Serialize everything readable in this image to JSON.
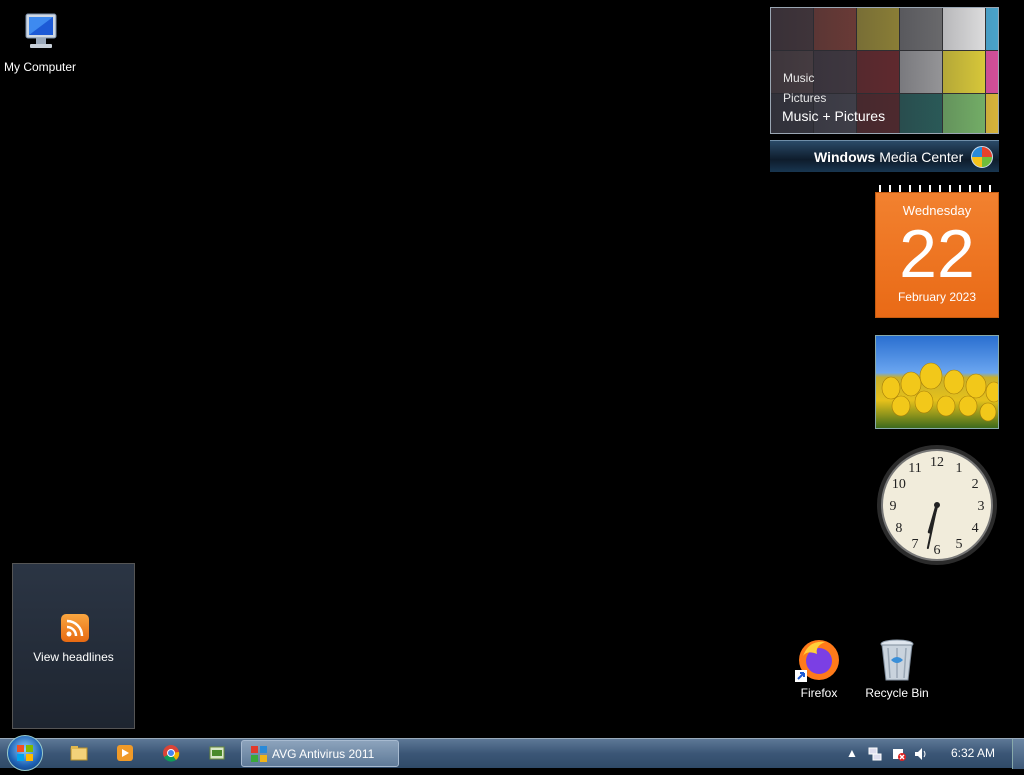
{
  "desktop": {
    "icons": [
      {
        "label": "My Computer",
        "icon": "computer-icon"
      },
      {
        "label": "Firefox",
        "icon": "firefox-icon"
      },
      {
        "label": "Recycle Bin",
        "icon": "recycle-bin-icon"
      }
    ]
  },
  "gadgets": {
    "media_center": {
      "menu": [
        "Music",
        "Pictures"
      ],
      "active": "Music + Pictures",
      "brand_bold": "Windows",
      "brand_rest": " Media Center"
    },
    "calendar": {
      "weekday": "Wednesday",
      "day": "22",
      "month_year": "February 2023"
    },
    "clock": {
      "hour": 6,
      "minute": 32,
      "numerals": [
        "12",
        "1",
        "2",
        "3",
        "4",
        "5",
        "6",
        "7",
        "8",
        "9",
        "10",
        "11"
      ]
    },
    "feed": {
      "label": "View headlines"
    }
  },
  "taskbar": {
    "pinned": [
      "explorer-icon",
      "media-player-icon",
      "chrome-icon",
      "utility-icon"
    ],
    "task": {
      "label": "AVG Antivirus 2011",
      "icon": "avg-icon"
    },
    "tray_icons": [
      "show-hidden-icons-arrow",
      "network-icon",
      "action-center-icon",
      "volume-icon"
    ],
    "time": "6:32 AM"
  }
}
